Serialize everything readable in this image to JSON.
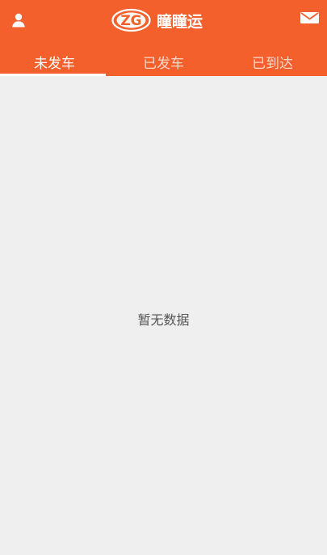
{
  "header": {
    "brand_name": "瞳瞳运",
    "logo_text": "ZG",
    "user_icon": "user-icon",
    "mail_icon": "mail-icon"
  },
  "tabs": [
    {
      "label": "未发车",
      "active": true
    },
    {
      "label": "已发车",
      "active": false
    },
    {
      "label": "已到达",
      "active": false
    }
  ],
  "content": {
    "empty_text": "暂无数据"
  },
  "colors": {
    "header_background": "#f4602c",
    "page_background": "#efefef",
    "active_tab_text": "#ffffff",
    "inactive_tab_text": "#fbd2c3",
    "empty_text": "#555555"
  }
}
